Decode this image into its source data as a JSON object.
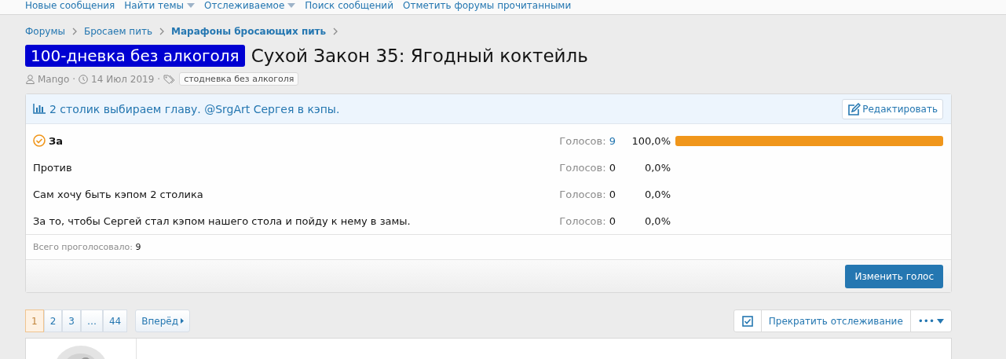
{
  "nav": [
    {
      "label": "Новые сообщения",
      "dropdown": false
    },
    {
      "label": "Найти темы",
      "dropdown": true
    },
    {
      "label": "Отслеживаемое",
      "dropdown": true
    },
    {
      "label": "Поиск сообщений",
      "dropdown": false
    },
    {
      "label": "Отметить форумы прочитанными",
      "dropdown": false
    }
  ],
  "breadcrumbs": [
    {
      "label": "Форумы",
      "current": false
    },
    {
      "label": "Бросаем пить",
      "current": false
    },
    {
      "label": "Марафоны бросающих пить",
      "current": true
    }
  ],
  "thread": {
    "separator": "·",
    "prefix": "100-дневка без алкоголя",
    "title": "Сухой Закон 35: Ягодный коктейль",
    "author": "Mango",
    "date": "14 Июл 2019",
    "tag": "стодневка без алкоголя"
  },
  "poll": {
    "question": "2 столик выбираем главу. @SrgArt Сергея в кэпы.",
    "edit_button": "Редактировать",
    "options": [
      {
        "label": "За",
        "voted": true,
        "votes_label": "Голосов:",
        "votes": "9",
        "percent": "100,0%",
        "level": 1
      },
      {
        "label": "Против",
        "voted": false,
        "votes_label": "Голосов:",
        "votes": "0",
        "percent": "0,0%"
      },
      {
        "label": "Сам хочу быть кэпом 2 столика",
        "voted": false,
        "votes_label": "Голосов:",
        "votes": "0",
        "percent": "0,0%"
      },
      {
        "label": "За то, чтобы Сергей стал кэпом нашего стола и пойду к нему в замы.",
        "voted": false,
        "votes_label": "Голосов:",
        "votes": "0",
        "percent": "0,0%"
      }
    ],
    "total_label": "Всего проголосовало:",
    "total": "9",
    "change_button": "Изменить голос"
  },
  "pagination": {
    "pages": [
      {
        "label": "1",
        "selected": true
      },
      {
        "label": "2",
        "selected": false
      },
      {
        "label": "3",
        "selected": false
      },
      {
        "label": "…",
        "selected": false
      },
      {
        "label": "44",
        "selected": false
      }
    ],
    "next": "Вперёд"
  },
  "watch": {
    "checked": true,
    "label": "Прекратить отслеживание",
    "more": "•••"
  }
}
